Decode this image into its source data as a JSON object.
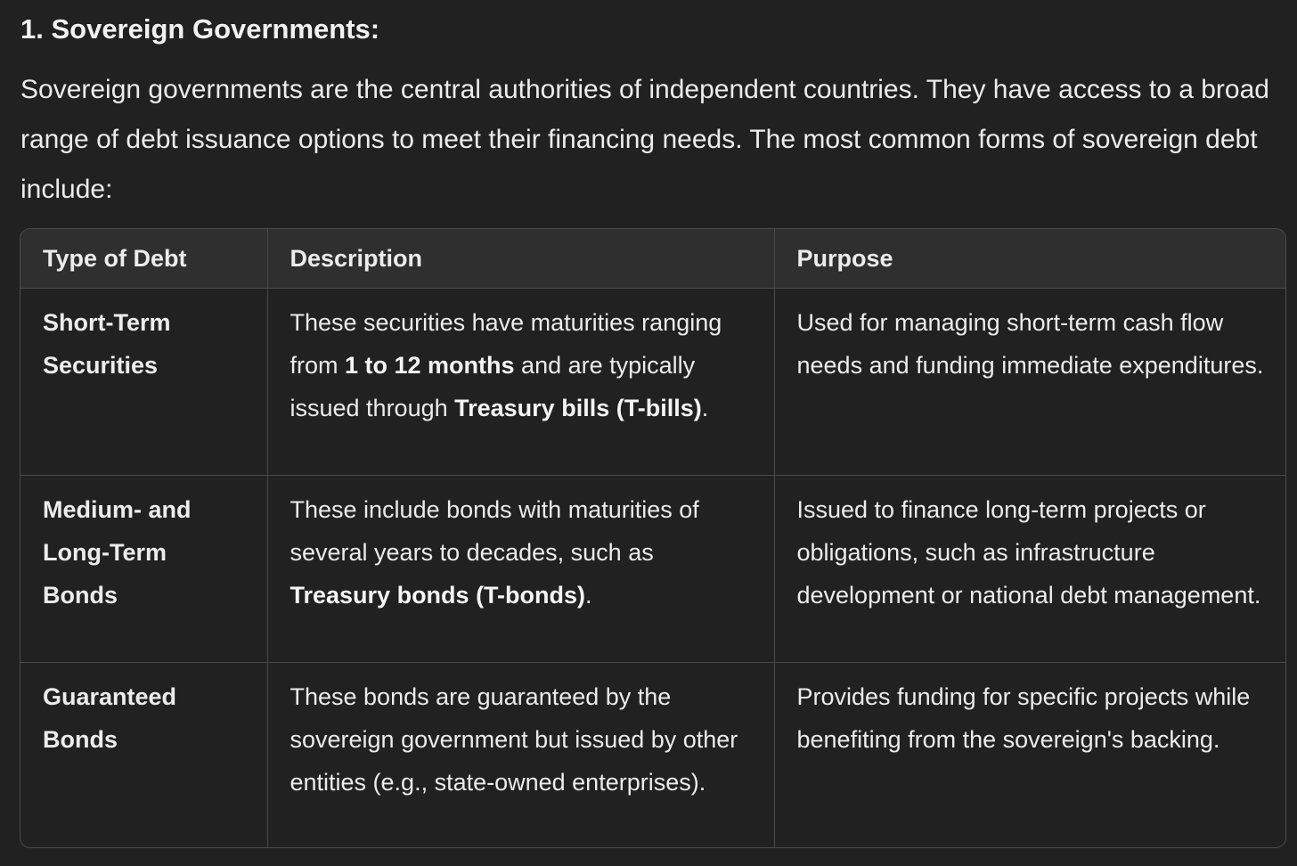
{
  "heading": "1. Sovereign Governments:",
  "intro": "Sovereign governments are the central authorities of independent countries. They have access to a broad range of debt issuance options to meet their financing needs. The most common forms of sovereign debt include:",
  "table": {
    "headers": {
      "type": "Type of Debt",
      "description": "Description",
      "purpose": "Purpose"
    },
    "rows": [
      {
        "type": "Short-Term Securities",
        "desc_1": "These securities have maturities ranging from ",
        "desc_bold_1": "1 to 12 months",
        "desc_2": " and are typically issued through ",
        "desc_bold_2": "Treasury bills (T-bills)",
        "desc_3": ".",
        "purpose": "Used for managing short-term cash flow needs and funding immediate expenditures."
      },
      {
        "type": "Medium- and Long-Term Bonds",
        "desc_1": "These include bonds with maturities of several years to decades, such as ",
        "desc_bold_1": "Treasury bonds (T-bonds)",
        "desc_2": ".",
        "purpose": "Issued to finance long-term projects or obligations, such as infrastructure development or national debt management."
      },
      {
        "type": "Guaranteed Bonds",
        "desc_1": "These bonds are guaranteed by the sovereign government but issued by other entities (e.g., state-owned enterprises).",
        "purpose": "Provides funding for specific projects while benefiting from the sovereign's backing."
      }
    ]
  }
}
